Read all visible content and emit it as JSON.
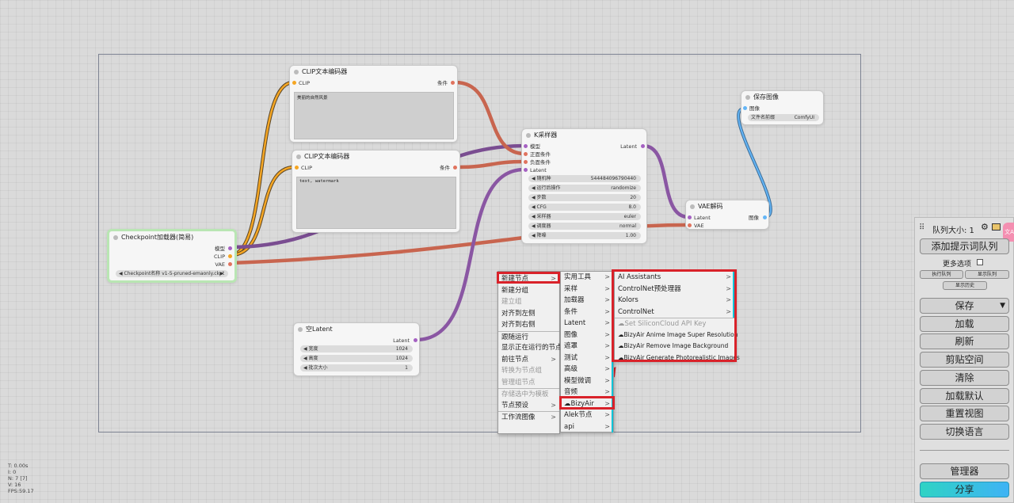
{
  "colors": {
    "canvas_bg": "#dadada",
    "clip_link": "#f5a623",
    "conditioning_link": "#e0735e",
    "model_link": "#9b5fb6",
    "latent_link": "#a561c2",
    "vae_link": "#e0735e",
    "image_link": "#64b5f6",
    "highlight": "#d9222a",
    "share_button": "#37c8e8"
  },
  "nodes": {
    "clip_encoder_1": {
      "title": "CLIP文本编码器",
      "input_clip": "CLIP",
      "output_cond": "条件",
      "text": "美丽的自然风景"
    },
    "clip_encoder_2": {
      "title": "CLIP文本编码器",
      "input_clip": "CLIP",
      "output_cond": "条件",
      "text": "text, watermark"
    },
    "checkpoint": {
      "title": "Checkpoint加载器(简易)",
      "out_model": "模型",
      "out_clip": "CLIP",
      "out_vae": "VAE",
      "widget_label": "Checkpoint名称",
      "widget_value": "v1-5-pruned-emaonly.ckpt"
    },
    "ksampler": {
      "title": "K采样器",
      "in_model": "模型",
      "in_positive": "正面条件",
      "in_negative": "负面条件",
      "in_latent": "Latent",
      "out_latent": "Latent",
      "widgets": [
        {
          "label": "随机种",
          "value": "544484096790440"
        },
        {
          "label": "运行后操作",
          "value": "randomize"
        },
        {
          "label": "步数",
          "value": "20"
        },
        {
          "label": "CFG",
          "value": "8.0"
        },
        {
          "label": "采样器",
          "value": "euler"
        },
        {
          "label": "调度器",
          "value": "normal"
        },
        {
          "label": "降噪",
          "value": "1.00"
        }
      ]
    },
    "vae_decode": {
      "title": "VAE解码",
      "in_latent": "Latent",
      "in_vae": "VAE",
      "out_image": "图像"
    },
    "save_image": {
      "title": "保存图像",
      "in_image": "图像",
      "widget_label": "文件名前缀",
      "widget_value": "ComfyUI"
    },
    "empty_latent": {
      "title": "空Latent",
      "out_latent": "Latent",
      "widgets": [
        {
          "label": "宽度",
          "value": "1024"
        },
        {
          "label": "高度",
          "value": "1024"
        },
        {
          "label": "批次大小",
          "value": "1"
        }
      ]
    }
  },
  "context_menu": {
    "main": [
      {
        "label": "新建节点",
        "arrow": ">"
      },
      {
        "label": "新建分组",
        "arrow": ""
      },
      {
        "label": "建立组",
        "arrow": "",
        "disabled": true
      },
      {
        "label": "对齐到左侧",
        "arrow": ""
      },
      {
        "label": "对齐到右侧",
        "arrow": ""
      },
      {
        "label": "跟随运行",
        "arrow": ""
      },
      {
        "label": "显示正在运行的节点",
        "arrow": ""
      },
      {
        "label": "前往节点",
        "arrow": ">"
      },
      {
        "label": "转换为节点组",
        "arrow": "",
        "disabled": true
      },
      {
        "label": "管理组节点",
        "arrow": "",
        "disabled": true
      },
      {
        "label": "存储选中为模板",
        "arrow": "",
        "disabled": true
      },
      {
        "label": "节点预设",
        "arrow": ">"
      },
      {
        "label": "工作流图像",
        "arrow": ">"
      }
    ],
    "categories": [
      {
        "label": "实用工具",
        "arrow": ">"
      },
      {
        "label": "采样",
        "arrow": ">"
      },
      {
        "label": "加载器",
        "arrow": ">"
      },
      {
        "label": "条件",
        "arrow": ">"
      },
      {
        "label": "Latent",
        "arrow": ">"
      },
      {
        "label": "图像",
        "arrow": ">"
      },
      {
        "label": "遮罩",
        "arrow": ">"
      },
      {
        "label": "测试",
        "arrow": ">"
      },
      {
        "label": "高级",
        "arrow": ">"
      },
      {
        "label": "模型微调",
        "arrow": ">"
      },
      {
        "label": "音频",
        "arrow": ">"
      },
      {
        "label": "BizyAir",
        "arrow": ">"
      },
      {
        "label": "Alek节点",
        "arrow": ">"
      },
      {
        "label": "api",
        "arrow": ">"
      }
    ],
    "bizyair": [
      {
        "label": "AI Assistants",
        "arrow": ">"
      },
      {
        "label": "ControlNet预处理器",
        "arrow": ">"
      },
      {
        "label": "Kolors",
        "arrow": ">"
      },
      {
        "label": "ControlNet",
        "arrow": ">"
      },
      {
        "label": "Set SiliconCloud API Key",
        "arrow": "",
        "disabled": true
      },
      {
        "label": "BizyAir Anime Image Super Resolution",
        "arrow": ""
      },
      {
        "label": "BizyAir Remove Image Background",
        "arrow": ""
      },
      {
        "label": "BizyAir Generate Photorealistic Images",
        "arrow": ""
      }
    ]
  },
  "panel": {
    "queue_size": "队列大小: 1",
    "add_prompt": "添加提示词队列",
    "more_options": "更多选项",
    "exec_queue": "执行队列",
    "show_queue": "显示队列",
    "show_history": "显示历史",
    "save": "保存",
    "load": "加载",
    "refresh": "刷新",
    "clipspace": "剪贴空间",
    "clear": "清除",
    "load_default": "加载默认",
    "reset_view": "重置视图",
    "switch_language": "切换语言",
    "manager": "管理器",
    "share": "分享",
    "side_badge": "文A"
  },
  "stats": {
    "t": "T: 0.00s",
    "i": "I: 0",
    "n": "N: 7 [7]",
    "v": "V: 16",
    "fps": "FPS:59.17"
  }
}
